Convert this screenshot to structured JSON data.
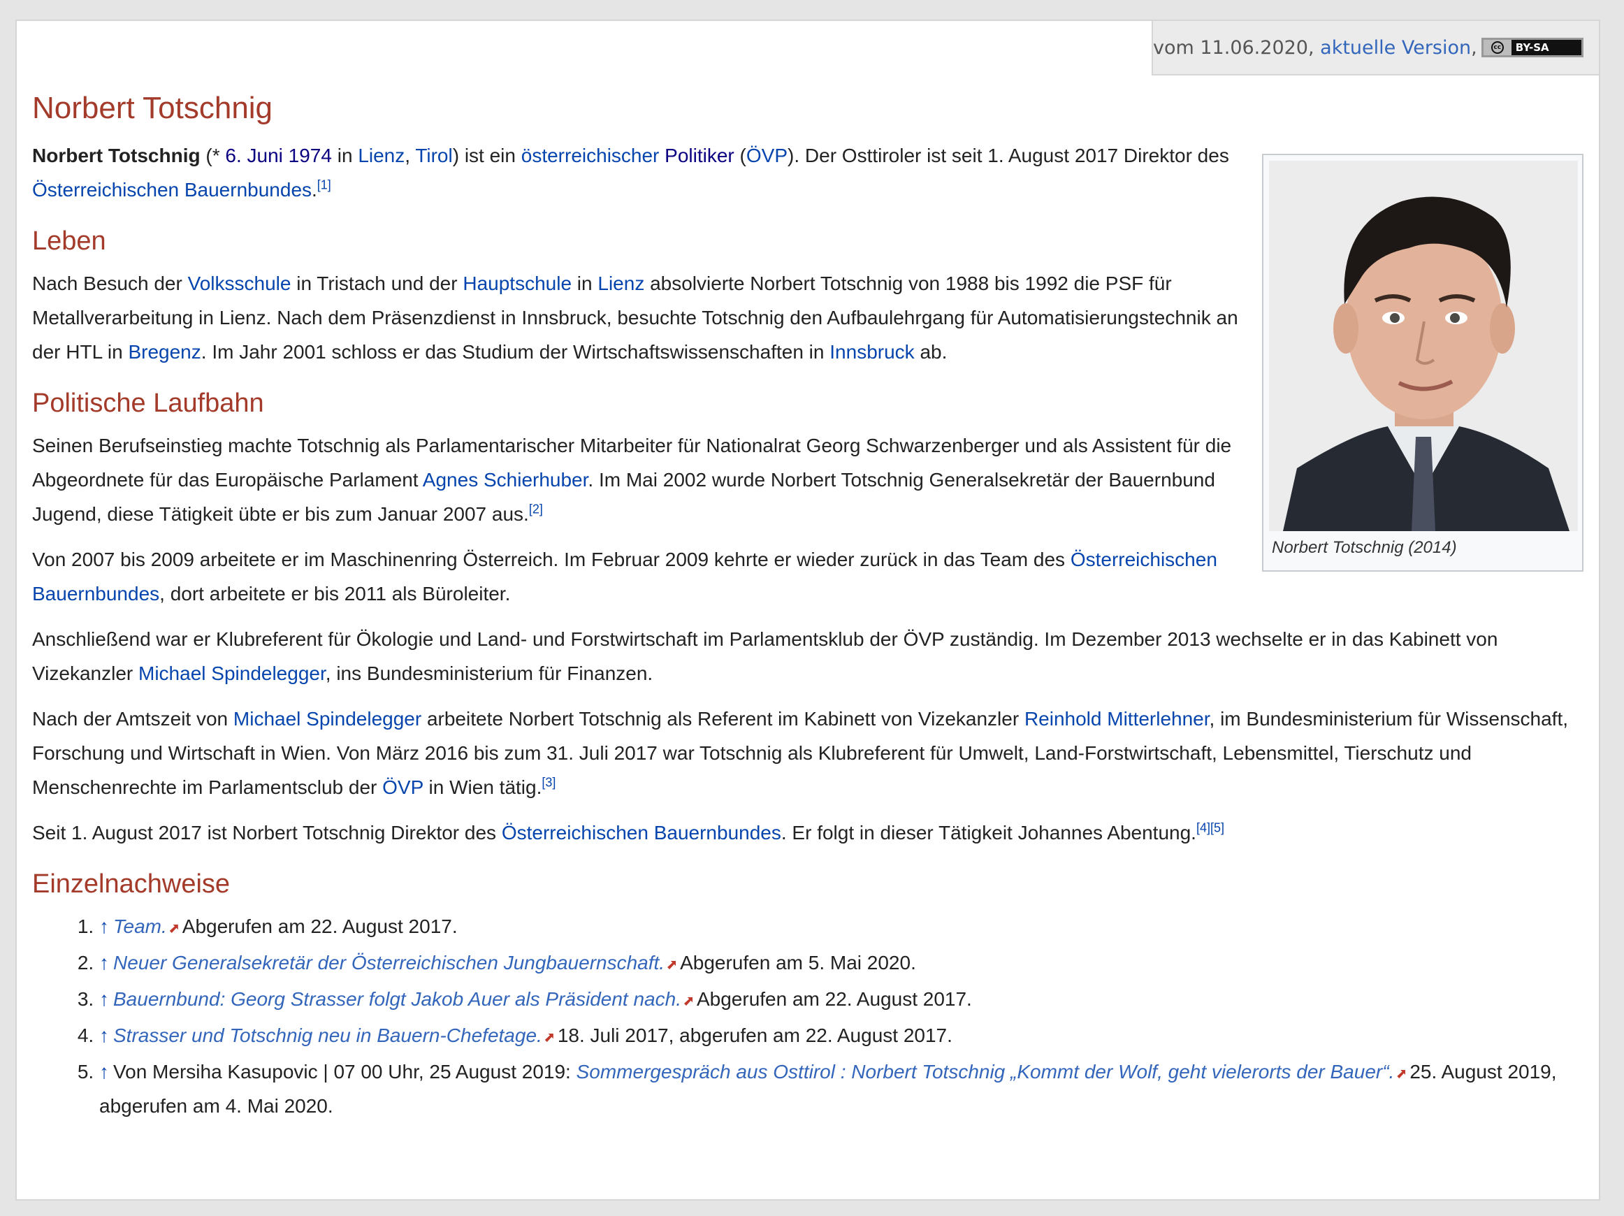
{
  "version_bar": {
    "prefix": "vom 11.06.2020,",
    "current_link": "aktuelle Version",
    "separator": ",",
    "license_badge": "BY-SA",
    "license_icon": "cc-icon"
  },
  "article": {
    "title": "Norbert Totschnig",
    "lead": {
      "name_bold": "Norbert Totschnig",
      "t1": " (* ",
      "birth_date": "6. Juni 1974",
      "t2": " in ",
      "birthplace": "Lienz",
      "t3": ", ",
      "state": "Tirol",
      "t4": ") ist ein ",
      "nationality": "österreichischer",
      "t5": " ",
      "profession": "Politiker",
      "t6": " (",
      "party": "ÖVP",
      "t7": "). Der Osttiroler ist seit 1. August 2017 Direktor des ",
      "org": "Österreichischen Bauernbundes",
      "t8": ".",
      "ref": "[1]"
    },
    "infobox": {
      "caption": "Norbert Totschnig (2014)",
      "photo_icon": "portrait-photo"
    },
    "sections": {
      "leben": {
        "heading": "Leben",
        "p1": {
          "t1": "Nach Besuch der ",
          "l1": "Volksschule",
          "t2": " in Tristach und der ",
          "l2": "Hauptschule",
          "t3": " in ",
          "l3": "Lienz",
          "t4": " absolvierte Norbert Totschnig von 1988 bis 1992 die PSF für Metallverarbeitung in Lienz. Nach dem Präsenzdienst in Innsbruck, besuchte Totschnig den Aufbaulehrgang für Automatisierungstechnik an der HTL in ",
          "l4": "Bregenz",
          "t5": ". Im Jahr 2001 schloss er das Studium der Wirtschaftswissenschaften in ",
          "l5": "Innsbruck",
          "t6": " ab."
        }
      },
      "laufbahn": {
        "heading": "Politische Laufbahn",
        "p1": {
          "t1": "Seinen Berufseinstieg machte Totschnig als Parlamentarischer Mitarbeiter für Nationalrat Georg Schwarzenberger und als Assistent für die Abgeordnete für das Europäische Parlament ",
          "l1": "Agnes Schierhuber",
          "t2": ". Im Mai 2002 wurde Norbert Totschnig Generalsekretär der Bauernbund Jugend, diese Tätigkeit übte er bis zum Januar 2007 aus.",
          "ref": "[2]"
        },
        "p2": {
          "t1": "Von 2007 bis 2009 arbeitete er im Maschinenring Österreich. Im Februar 2009 kehrte er wieder zurück in das Team des ",
          "l1": "Österreichischen Bauernbundes",
          "t2": ", dort arbeitete er bis 2011 als Büroleiter."
        },
        "p3": {
          "t1": "Anschließend war er Klubreferent für Ökologie und Land- und Forstwirtschaft im Parlamentsklub der ÖVP zuständig. Im Dezember 2013 wechselte er in das Kabinett von Vizekanzler ",
          "l1": "Michael Spindelegger",
          "t2": ", ins Bundesministerium für Finanzen."
        },
        "p4": {
          "t1": "Nach der Amtszeit von ",
          "l1": "Michael Spindelegger",
          "t2": " arbeitete Norbert Totschnig als Referent im Kabinett von Vizekanzler ",
          "l2": "Reinhold Mitterlehner",
          "t3": ", im Bundesministerium für Wissenschaft, Forschung und Wirtschaft in Wien. Von März 2016 bis zum 31. Juli 2017 war Totschnig als Klubreferent für Umwelt, Land-Forstwirtschaft, Lebensmittel, Tierschutz und Menschenrechte im Parlamentsclub der ",
          "l3": "ÖVP",
          "t4": " in Wien tätig.",
          "ref": "[3]"
        },
        "p5": {
          "t1": "Seit 1. August 2017 ist Norbert Totschnig Direktor des ",
          "l1": "Österreichischen Bauernbundes",
          "t2": ". Er folgt in dieser Tätigkeit Johannes Abentung.",
          "ref1": "[4]",
          "ref2": "[5]"
        }
      },
      "refs": {
        "heading": "Einzelnachweise",
        "items": [
          {
            "up": "↑",
            "pre": "",
            "link": "Team.",
            "post": "Abgerufen am 22. August 2017."
          },
          {
            "up": "↑",
            "pre": "",
            "link": "Neuer Generalsekretär der Österreichischen Jungbauernschaft.",
            "post": "Abgerufen am 5. Mai 2020."
          },
          {
            "up": "↑",
            "pre": "",
            "link": "Bauernbund: Georg Strasser folgt Jakob Auer als Präsident nach.",
            "post": "Abgerufen am 22. August 2017."
          },
          {
            "up": "↑",
            "pre": "",
            "link": "Strasser und Totschnig neu in Bauern-Chefetage.",
            "post": "18. Juli 2017, abgerufen am 22. August 2017."
          },
          {
            "up": "↑",
            "pre": "Von Mersiha Kasupovic | 07 00 Uhr, 25 August 2019: ",
            "link": "Sommergespräch aus Osttirol : Norbert Totschnig „Kommt der Wolf, geht vielerorts der Bauer“.",
            "post": "25. August 2019, abgerufen am 4. Mai 2020."
          }
        ]
      }
    }
  }
}
